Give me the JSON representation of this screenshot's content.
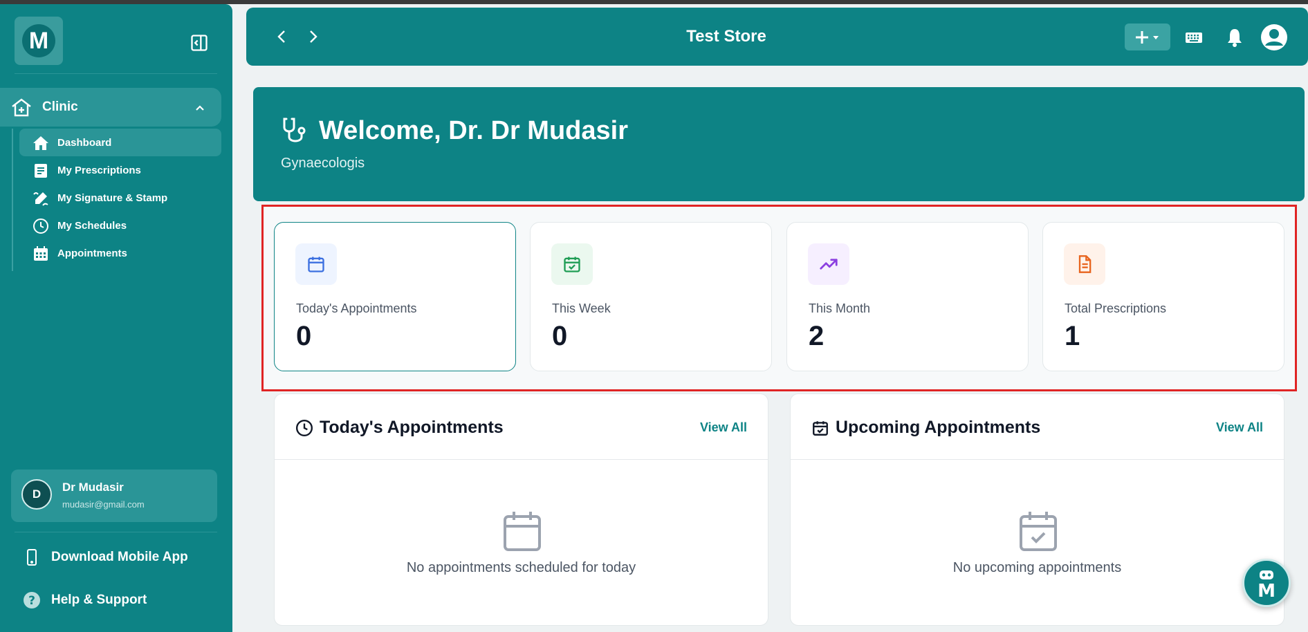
{
  "sidebar": {
    "logo_letter": "M",
    "section_label": "Clinic",
    "items": [
      {
        "label": "Dashboard",
        "active": true
      },
      {
        "label": "My Prescriptions"
      },
      {
        "label": "My Signature & Stamp"
      },
      {
        "label": "My Schedules"
      },
      {
        "label": "Appointments"
      }
    ],
    "user": {
      "initial": "D",
      "name": "Dr Mudasir",
      "email": "mudasir@gmail.com"
    },
    "download_label": "Download Mobile App",
    "help_label": "Help & Support"
  },
  "header": {
    "title": "Test Store"
  },
  "welcome": {
    "title": "Welcome, Dr. Dr Mudasir",
    "subtitle": "Gynaecologis"
  },
  "stats": [
    {
      "label": "Today's Appointments",
      "value": "0"
    },
    {
      "label": "This Week",
      "value": "0"
    },
    {
      "label": "This Month",
      "value": "2"
    },
    {
      "label": "Total Prescriptions",
      "value": "1"
    }
  ],
  "panels": {
    "today": {
      "title": "Today's Appointments",
      "view_all": "View All",
      "empty": "No appointments scheduled for today"
    },
    "upcoming": {
      "title": "Upcoming Appointments",
      "view_all": "View All",
      "empty": "No upcoming appointments"
    }
  },
  "colors": {
    "brand": "#0d8385",
    "highlight": "#e02424"
  }
}
